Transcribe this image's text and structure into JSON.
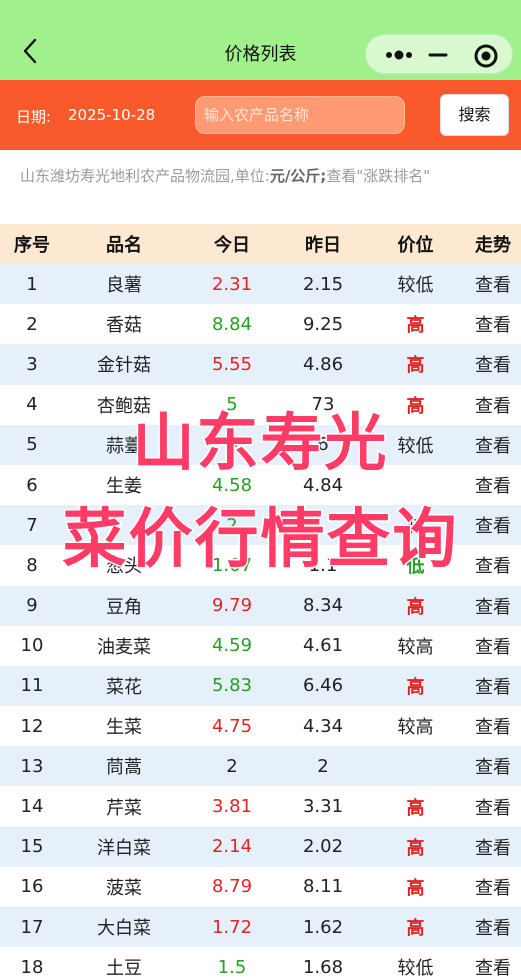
{
  "nav": {
    "title": "价格列表",
    "back_icon": "chevron-left-icon",
    "more_icon": "more-dots-icon",
    "minimize_icon": "minimize-icon",
    "close_icon": "target-close-icon"
  },
  "filter": {
    "date_label": "日期:",
    "date_value": "2025-10-28",
    "search_placeholder": "输入农产品名称",
    "search_button": "搜索"
  },
  "notice": {
    "prefix": "山东潍坊寿光地利农产品物流园,单位:",
    "unit": "元/公斤;",
    "suffix": "查看\"涨跌排名\""
  },
  "table": {
    "headers": [
      "序号",
      "品名",
      "今日",
      "昨日",
      "价位",
      "走势"
    ],
    "rows": [
      {
        "no": "1",
        "name": "良薯",
        "today": "2.31",
        "yesterday": "2.15",
        "level": "较低",
        "trend": "查看",
        "today_color": "red",
        "level_style": "plain"
      },
      {
        "no": "2",
        "name": "香菇",
        "today": "8.84",
        "yesterday": "9.25",
        "level": "高",
        "trend": "查看",
        "today_color": "green",
        "level_style": "high"
      },
      {
        "no": "3",
        "name": "金针菇",
        "today": "5.55",
        "yesterday": "4.86",
        "level": "高",
        "trend": "查看",
        "today_color": "red",
        "level_style": "high"
      },
      {
        "no": "4",
        "name": "杏鲍菇",
        "today": "5",
        "yesterday": "73",
        "level": "高",
        "trend": "查看",
        "today_color": "green",
        "level_style": "high"
      },
      {
        "no": "5",
        "name": "蒜薹",
        "today": "4",
        "yesterday": "6",
        "level": "较低",
        "trend": "查看",
        "today_color": "green",
        "level_style": "plain"
      },
      {
        "no": "6",
        "name": "生姜",
        "today": "4.58",
        "yesterday": "4.84",
        "level": "",
        "trend": "查看",
        "today_color": "green",
        "level_style": "plain"
      },
      {
        "no": "7",
        "name": "",
        "today": "2",
        "yesterday": "",
        "level": "较",
        "trend": "查看",
        "today_color": "green",
        "level_style": "plain"
      },
      {
        "no": "8",
        "name": "葱头",
        "today": "1.07",
        "yesterday": "1.1",
        "level": "低",
        "trend": "查看",
        "today_color": "green",
        "level_style": "low"
      },
      {
        "no": "9",
        "name": "豆角",
        "today": "9.79",
        "yesterday": "8.34",
        "level": "高",
        "trend": "查看",
        "today_color": "red",
        "level_style": "high"
      },
      {
        "no": "10",
        "name": "油麦菜",
        "today": "4.59",
        "yesterday": "4.61",
        "level": "较高",
        "trend": "查看",
        "today_color": "green",
        "level_style": "plain"
      },
      {
        "no": "11",
        "name": "菜花",
        "today": "5.83",
        "yesterday": "6.46",
        "level": "高",
        "trend": "查看",
        "today_color": "green",
        "level_style": "high"
      },
      {
        "no": "12",
        "name": "生菜",
        "today": "4.75",
        "yesterday": "4.34",
        "level": "较高",
        "trend": "查看",
        "today_color": "red",
        "level_style": "plain"
      },
      {
        "no": "13",
        "name": "茼蒿",
        "today": "2",
        "yesterday": "2",
        "level": "",
        "trend": "查看",
        "today_color": "plain",
        "level_style": "plain"
      },
      {
        "no": "14",
        "name": "芹菜",
        "today": "3.81",
        "yesterday": "3.31",
        "level": "高",
        "trend": "查看",
        "today_color": "red",
        "level_style": "high"
      },
      {
        "no": "15",
        "name": "洋白菜",
        "today": "2.14",
        "yesterday": "2.02",
        "level": "高",
        "trend": "查看",
        "today_color": "red",
        "level_style": "high"
      },
      {
        "no": "16",
        "name": "菠菜",
        "today": "8.79",
        "yesterday": "8.11",
        "level": "高",
        "trend": "查看",
        "today_color": "red",
        "level_style": "high"
      },
      {
        "no": "17",
        "name": "大白菜",
        "today": "1.72",
        "yesterday": "1.62",
        "level": "高",
        "trend": "查看",
        "today_color": "red",
        "level_style": "high"
      },
      {
        "no": "18",
        "name": "土豆",
        "today": "1.5",
        "yesterday": "1.68",
        "level": "较低",
        "trend": "查看",
        "today_color": "green",
        "level_style": "plain"
      }
    ]
  },
  "overlay": {
    "line1": "山东寿光",
    "line2": "菜价行情查询"
  },
  "colors": {
    "nav_bg": "#a0f08c",
    "filter_bg": "#fa5a2b",
    "header_bg": "#fde9d2",
    "row_alt_bg": "#e6f0fa",
    "price_up": "#e02424",
    "price_down": "#23a021",
    "overlay_text": "#ff3b66"
  }
}
